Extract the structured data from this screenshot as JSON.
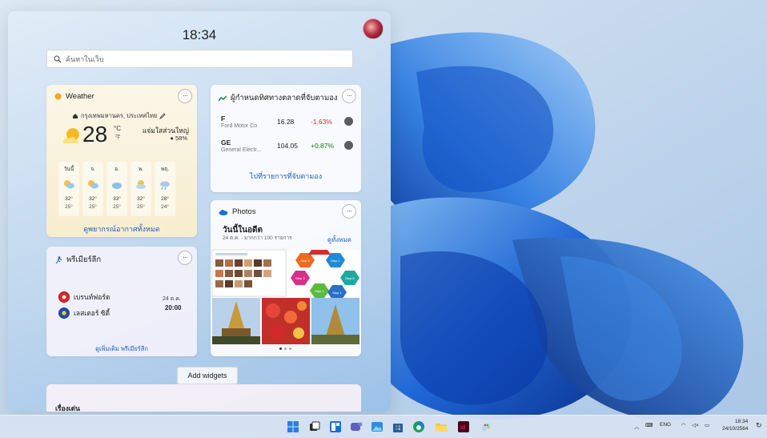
{
  "panel": {
    "clock": "18:34",
    "search_placeholder": "ค้นหาในเว็บ"
  },
  "weather": {
    "title": "Weather",
    "location": "กรุงเทพมหานคร, ประเทศไทย",
    "temperature": "28",
    "unit_c": "°C",
    "unit_f": "°F",
    "condition": "แจ่มใสส่วนใหญ่",
    "humidity": "58%",
    "forecast": [
      {
        "day": "วันนี้",
        "hi": "32°",
        "lo": "25°",
        "icon": "partly-cloudy-rain-icon"
      },
      {
        "day": "จ.",
        "hi": "32°",
        "lo": "25°",
        "icon": "partly-cloudy-rain-icon"
      },
      {
        "day": "อ.",
        "hi": "33°",
        "lo": "25°",
        "icon": "cloudy-icon"
      },
      {
        "day": "พ.",
        "hi": "32°",
        "lo": "25°",
        "icon": "partly-cloudy-icon"
      },
      {
        "day": "พฤ.",
        "hi": "28°",
        "lo": "24°",
        "icon": "rain-icon"
      }
    ],
    "link": "ดูพยากรณ์อากาศทั้งหมด"
  },
  "stocks": {
    "title": "ผู้กำหนดทิศทางตลาดที่จับตามอง",
    "items": [
      {
        "symbol": "F",
        "name": "Ford Motor Co",
        "price": "16.28",
        "change": "-1.63%",
        "change_color": "#d13438"
      },
      {
        "symbol": "GE",
        "name": "General Electr...",
        "price": "104.05",
        "change": "+0.87%",
        "change_color": "#107c10"
      }
    ],
    "link": "ไปที่รายการที่จับตามอง"
  },
  "photos": {
    "title": "Photos",
    "heading": "วันนี้ในอดีต",
    "subheading": "24 ต.ค. - มากกว่า 100 รายการ",
    "see_all": "ดูทั้งหมด",
    "step_labels": [
      "Step 1",
      "Step 2",
      "Step 3",
      "Step 4",
      "Step 5",
      "Step 6"
    ]
  },
  "league": {
    "title": "พรีเมียร์ลีก",
    "home": "เบรนท์ฟอร์ด",
    "away": "เลสเตอร์ ซิตี้",
    "date": "24 ต.ค.",
    "time": "20:00",
    "link": "ดูเพิ่มเติม พรีเมียร์ลีก"
  },
  "add_widgets": "Add widgets",
  "featured": "เรื่องเด่น",
  "taskbar": {
    "language": "ENG",
    "time": "18:34",
    "date": "24/10/2564"
  }
}
